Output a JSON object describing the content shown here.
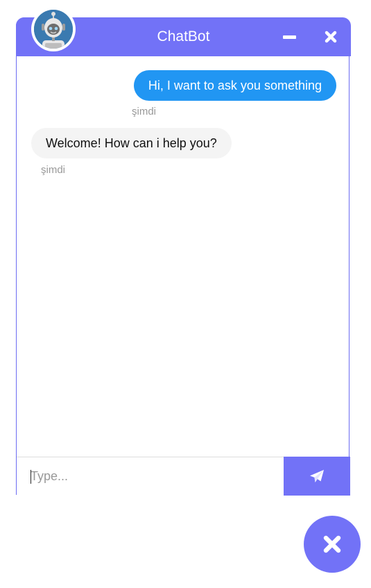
{
  "header": {
    "title": "ChatBot",
    "avatar_icon": "robot-icon",
    "minimize_icon": "minus-icon",
    "close_icon": "close-icon"
  },
  "messages": [
    {
      "sender": "user",
      "text": "Hi, I want to ask you something",
      "time": "şimdi"
    },
    {
      "sender": "bot",
      "text": "Welcome! How can i help you?",
      "time": "şimdi"
    }
  ],
  "composer": {
    "placeholder": "Type...",
    "value": "",
    "send_icon": "paper-plane-icon"
  },
  "launcher": {
    "icon": "close-icon"
  },
  "colors": {
    "accent": "#7272f7",
    "user_bubble": "#2196f3",
    "bot_bubble": "#f4f4f4",
    "timestamp": "#999999"
  }
}
